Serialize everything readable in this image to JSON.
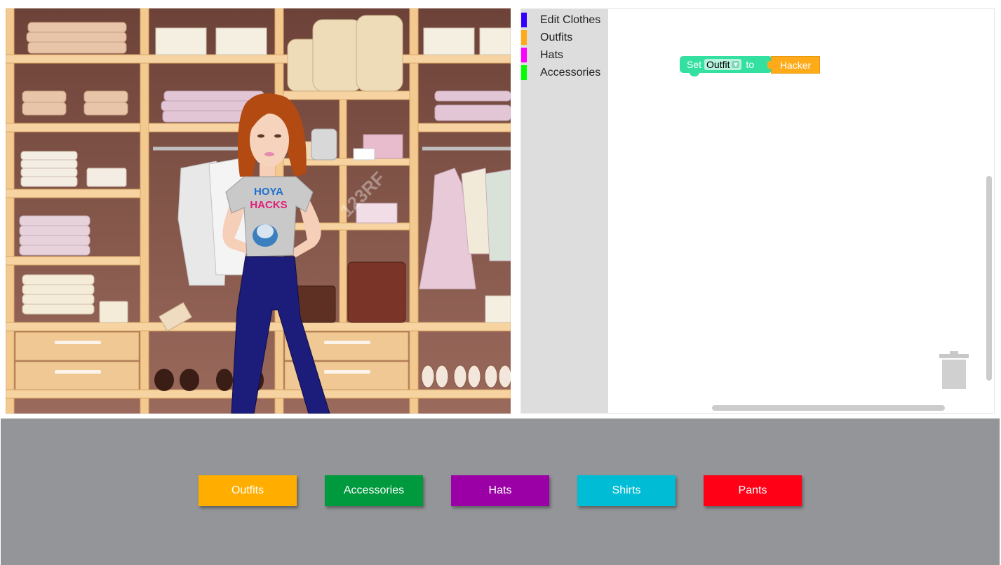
{
  "toolbox": {
    "items": [
      {
        "label": "Edit Clothes",
        "color": "#3300ff"
      },
      {
        "label": "Outfits",
        "color": "#ffab19"
      },
      {
        "label": "Hats",
        "color": "#ff00ff"
      },
      {
        "label": "Accessories",
        "color": "#00ff00"
      }
    ]
  },
  "workspace": {
    "set_block": {
      "keyword_set": "Set",
      "variable": "Outfit",
      "keyword_to": "to",
      "value": "Hacker",
      "block_color": "#33e0a0",
      "value_color": "#ffab19"
    }
  },
  "stage": {
    "shirt_text_line1": "HOYA",
    "shirt_text_line2": "HACKS",
    "watermark": "123RF"
  },
  "buttons": [
    {
      "label": "Outfits",
      "color": "#ffae00"
    },
    {
      "label": "Accessories",
      "color": "#009a3e"
    },
    {
      "label": "Hats",
      "color": "#9b00a6"
    },
    {
      "label": "Shirts",
      "color": "#00bcd4"
    },
    {
      "label": "Pants",
      "color": "#ff0017"
    }
  ]
}
